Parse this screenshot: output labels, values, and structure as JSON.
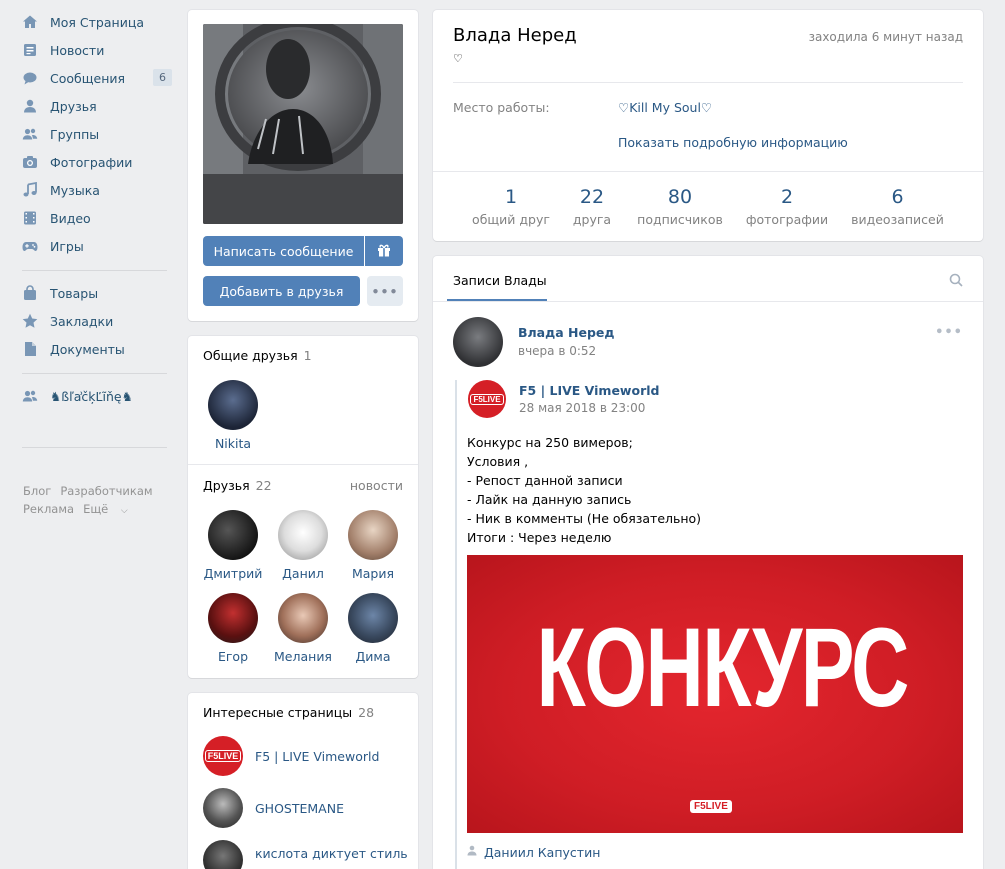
{
  "nav": {
    "items": [
      {
        "label": "Моя Страница",
        "icon": "home-icon"
      },
      {
        "label": "Новости",
        "icon": "news-icon"
      },
      {
        "label": "Сообщения",
        "icon": "messages-icon",
        "badge": "6"
      },
      {
        "label": "Друзья",
        "icon": "friends-icon"
      },
      {
        "label": "Группы",
        "icon": "groups-icon"
      },
      {
        "label": "Фотографии",
        "icon": "camera-icon"
      },
      {
        "label": "Музыка",
        "icon": "music-icon"
      },
      {
        "label": "Видео",
        "icon": "video-icon"
      },
      {
        "label": "Игры",
        "icon": "games-icon"
      },
      {
        "label": "Товары",
        "icon": "shopping-bag-icon"
      },
      {
        "label": "Закладки",
        "icon": "star-icon"
      },
      {
        "label": "Документы",
        "icon": "document-icon"
      },
      {
        "label": "♞ßľẚčķĽĩňę♞",
        "icon": "group-people-icon"
      }
    ],
    "footer": [
      "Блог",
      "Разработчикам",
      "Реклама",
      "Ещё"
    ]
  },
  "profile": {
    "name": "Влада Неред",
    "status": "♡",
    "last_seen": "заходила 6 минут назад",
    "work_label": "Место работы:",
    "work_value": "♡Kill My Soul♡",
    "show_more": "Показать подробную информацию",
    "counters": [
      {
        "num": "1",
        "label": "общий друг"
      },
      {
        "num": "22",
        "label": "друга"
      },
      {
        "num": "80",
        "label": "подписчиков"
      },
      {
        "num": "2",
        "label": "фотографии"
      },
      {
        "num": "6",
        "label": "видеозаписей"
      }
    ]
  },
  "actions": {
    "message": "Написать сообщение",
    "add_friend": "Добавить в друзья"
  },
  "common_friends": {
    "title": "Общие друзья",
    "count": "1",
    "items": [
      {
        "name": "Nikita"
      }
    ]
  },
  "friends": {
    "title": "Друзья",
    "count": "22",
    "news_link": "новости",
    "items": [
      {
        "name": "Дмитрий"
      },
      {
        "name": "Данил"
      },
      {
        "name": "Мария"
      },
      {
        "name": "Егор"
      },
      {
        "name": "Мелания"
      },
      {
        "name": "Дима"
      }
    ]
  },
  "pages": {
    "title": "Интересные страницы",
    "count": "28",
    "items": [
      {
        "name": "F5 | LIVE Vimeworld"
      },
      {
        "name": "GHOSTEMANE"
      },
      {
        "name": "кислота диктует стиль"
      }
    ]
  },
  "wall": {
    "tab": "Записи Влады",
    "post": {
      "author": "Влада Неред",
      "time": "вчера в 0:52",
      "repost_author": "F5 | LIVE Vimeworld",
      "repost_time": "28 мая 2018 в 23:00",
      "lines": [
        "Конкурс на 250 вимеров;",
        "Условия ,",
        "- Репост данной записи",
        "- Лайк на данную запись",
        "- Ник в комменты (Не обязательно)",
        "Итоги : Через неделю"
      ],
      "image_text": "КОНКУРС",
      "image_logo": "F5LIVE",
      "signer": "Даниил Капустин"
    }
  },
  "colors": {
    "accent": "#5181b8",
    "link": "#2a5885",
    "bg": "#edeef0",
    "contest_red": "#d51f26"
  }
}
